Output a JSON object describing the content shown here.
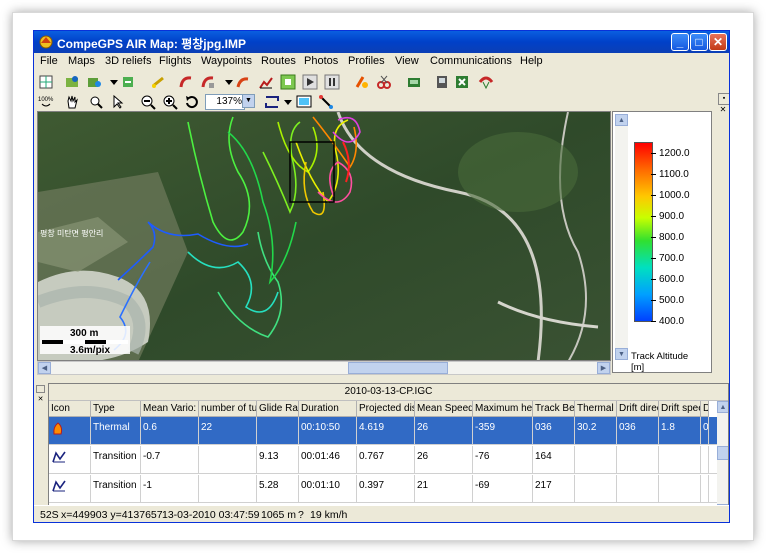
{
  "window": {
    "title": "CompeGPS AIR Map: 평창jpg.IMP",
    "minimize_label": "_",
    "maximize_label": "□",
    "close_label": "✕"
  },
  "menu": [
    "File",
    "Maps",
    "3D reliefs",
    "Flights",
    "Waypoints",
    "Routes",
    "Photos",
    "Profiles",
    "View",
    "Communications",
    "Help"
  ],
  "toolbar": {
    "zoom_value": "137%",
    "percent_badge": "100%"
  },
  "map": {
    "scale_distance": "300 m",
    "scale_resolution": "3.6m/pix",
    "place_label": "평창 미탄면 평안리"
  },
  "legend": {
    "ticks": [
      "1200.0",
      "1100.0",
      "1000.0",
      "900.0",
      "800.0",
      "700.0",
      "600.0",
      "500.0",
      "400.0"
    ],
    "title": "Track Altitude",
    "unit": "[m]"
  },
  "table": {
    "title": "2010-03-13-CP.IGC",
    "headers": [
      "Icon",
      "Type",
      "Mean Vario:",
      "number of turn",
      "Glide Ratio",
      "Duration",
      "Projected dist.",
      "Mean Speed",
      "Maximum heig",
      "Track Bea",
      "Thermal ra",
      "Drift direc",
      "Drift spee",
      "D"
    ],
    "rows": [
      [
        "",
        "Thermal",
        "0.6",
        "22",
        "",
        "00:10:50",
        "4.619",
        "26",
        "-359",
        "036",
        "30.2",
        "036",
        "1.8",
        "0."
      ],
      [
        "",
        "Transition",
        "-0.7",
        "",
        "9.13",
        "00:01:46",
        "0.767",
        "26",
        "-76",
        "164",
        "",
        "",
        "",
        ""
      ],
      [
        "",
        "Transition",
        "-1",
        "",
        "5.28",
        "00:01:10",
        "0.397",
        "21",
        "-69",
        "217",
        "",
        "",
        "",
        ""
      ]
    ]
  },
  "status": {
    "zone": "52S",
    "coords": "x=449903  y=4137657",
    "datetime": "13-03-2010  03:47:59",
    "altitude": "1065 m",
    "help": "?",
    "speed": "19 km/h"
  },
  "colors": {
    "title_bar": "#0a5fe0",
    "selection": "#316ac5",
    "track_low": "#0040ff",
    "track_high": "#ff0000"
  }
}
